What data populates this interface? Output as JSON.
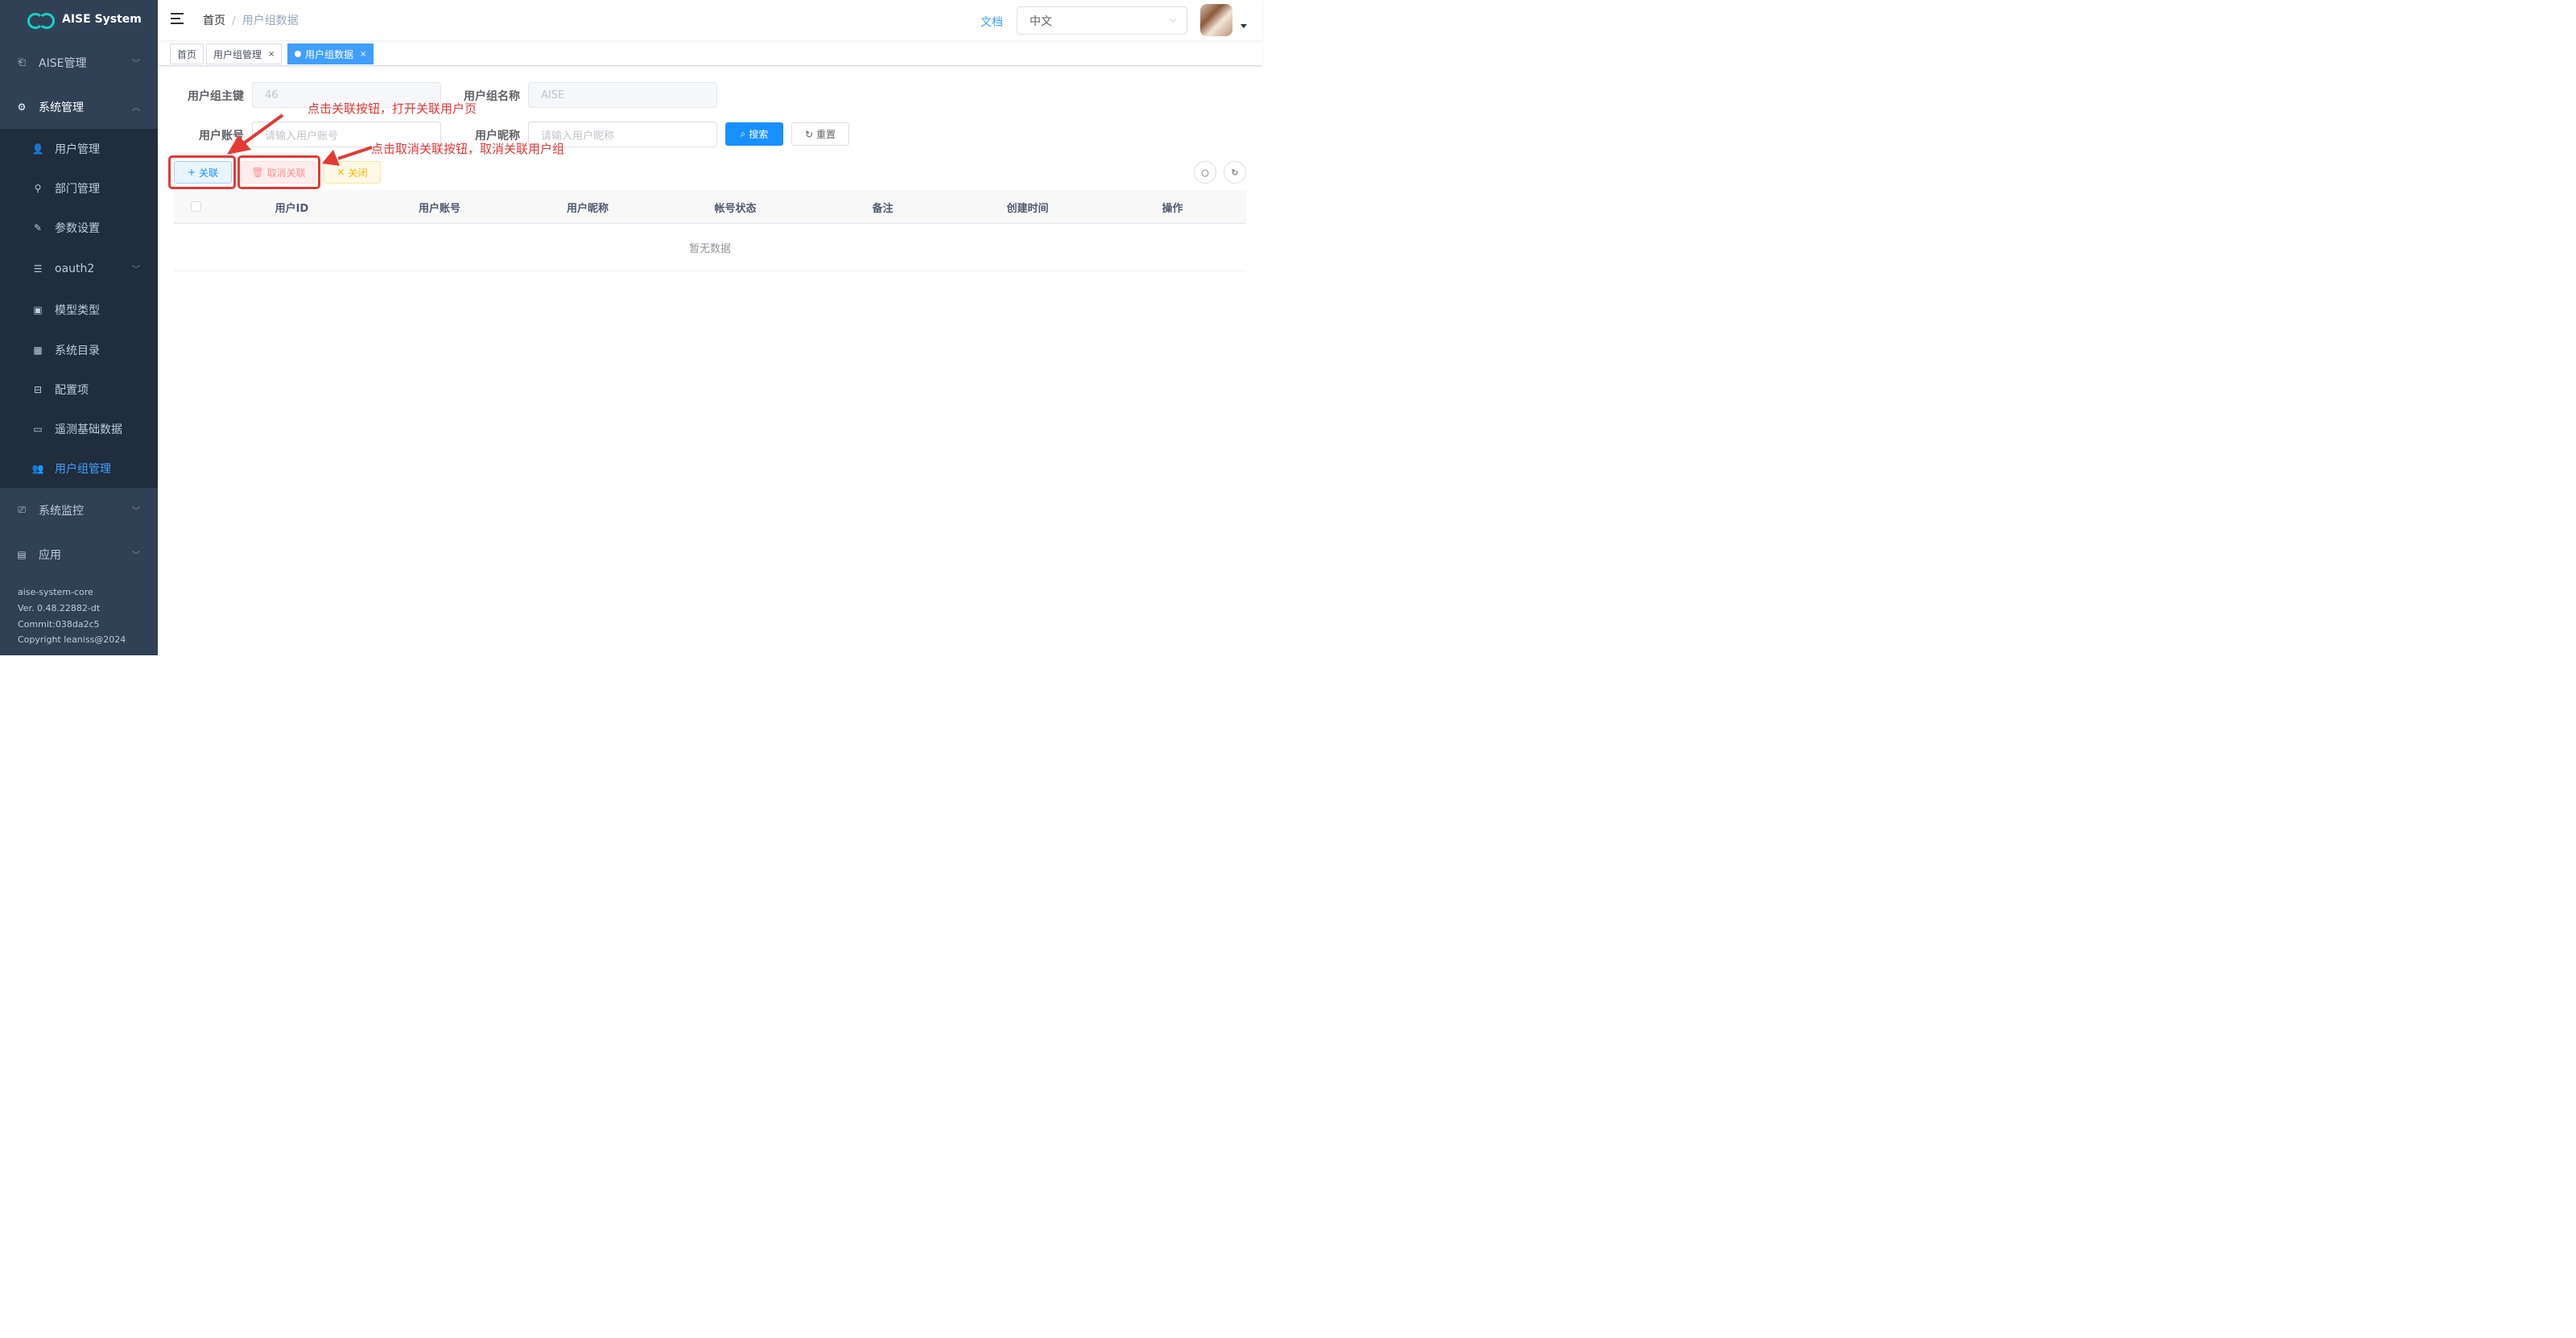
{
  "brand": {
    "title": "AISE System"
  },
  "sidebar": {
    "items": [
      {
        "label": "AISE管理",
        "icon": "puzzle-icon"
      },
      {
        "label": "系统管理",
        "icon": "gear-icon"
      },
      {
        "label": "系统监控",
        "icon": "monitor-icon"
      },
      {
        "label": "应用",
        "icon": "document-icon"
      }
    ],
    "sub_items": [
      {
        "label": "用户管理",
        "icon": "user-icon"
      },
      {
        "label": "部门管理",
        "icon": "tree-icon"
      },
      {
        "label": "参数设置",
        "icon": "edit-icon"
      },
      {
        "label": "oauth2",
        "icon": "list-icon"
      },
      {
        "label": "模型类型",
        "icon": "image-icon"
      },
      {
        "label": "系统目录",
        "icon": "calendar-icon"
      },
      {
        "label": "配置项",
        "icon": "briefcase-icon"
      },
      {
        "label": "遥测基础数据",
        "icon": "screen-icon"
      },
      {
        "label": "用户组管理",
        "icon": "users-icon"
      }
    ],
    "footer": {
      "app": "aise-system-core",
      "version": "Ver. 0.48.22882-dt",
      "commit": "Commit:038da2c5",
      "copyright": "Copyright leaniss@2024"
    }
  },
  "navbar": {
    "breadcrumb": [
      "首页",
      "用户组数据"
    ],
    "doc_link": "文档",
    "language": "中文"
  },
  "tags": [
    {
      "label": "首页"
    },
    {
      "label": "用户组管理"
    },
    {
      "label": "用户组数据"
    }
  ],
  "form": {
    "group_key_label": "用户组主键",
    "group_key_value": "46",
    "group_name_label": "用户组名称",
    "group_name_value": "AISE",
    "account_label": "用户账号",
    "account_placeholder": "请输入用户账号",
    "nickname_label": "用户昵称",
    "nickname_placeholder": "请输入用户昵称",
    "search_label": "搜索",
    "reset_label": "重置"
  },
  "toolbar": {
    "link_label": "关联",
    "unlink_label": "取消关联",
    "close_label": "关闭"
  },
  "annotations": {
    "link_note": "点击关联按钮，打开关联用户页",
    "unlink_note": "点击取消关联按钮，取消关联用户组"
  },
  "table": {
    "columns": [
      "用户ID",
      "用户账号",
      "用户昵称",
      "帐号状态",
      "备注",
      "创建时间",
      "操作"
    ],
    "empty_text": "暂无数据"
  },
  "colors": {
    "sidebar_bg": "#304156",
    "submenu_bg": "#1f2d3d",
    "primary": "#1890ff",
    "active_menu": "#409eff",
    "annotation_red": "#e53935"
  }
}
